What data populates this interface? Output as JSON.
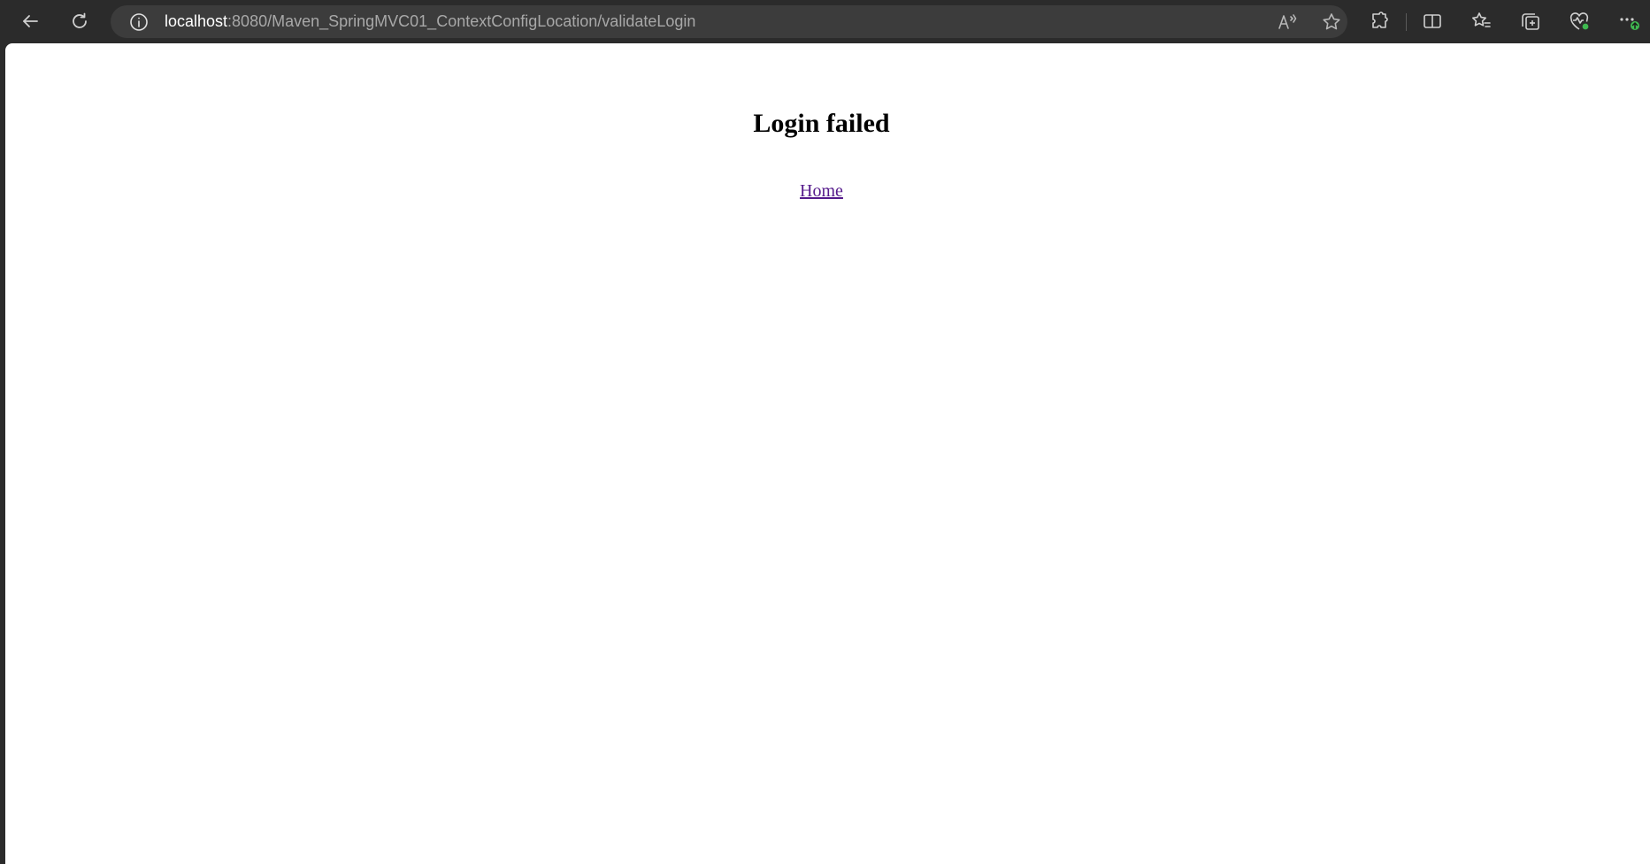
{
  "browser": {
    "url_host": "localhost",
    "url_path": ":8080/Maven_SpringMVC01_ContextConfigLocation/validateLogin",
    "icons": [
      "back-icon",
      "refresh-icon",
      "site-info-icon",
      "read-aloud-icon",
      "favorite-star-icon",
      "extensions-icon",
      "split-screen-icon",
      "favorites-icon",
      "collections-icon",
      "browser-essentials-icon",
      "more-menu-icon"
    ]
  },
  "page": {
    "heading": "Login failed",
    "home_link": "Home"
  },
  "colors": {
    "toolbar_bg": "#2b2b2b",
    "address_bar_bg": "#3c3c3c",
    "visited_link": "#551a8b",
    "essentials_badge": "#3fb950"
  }
}
